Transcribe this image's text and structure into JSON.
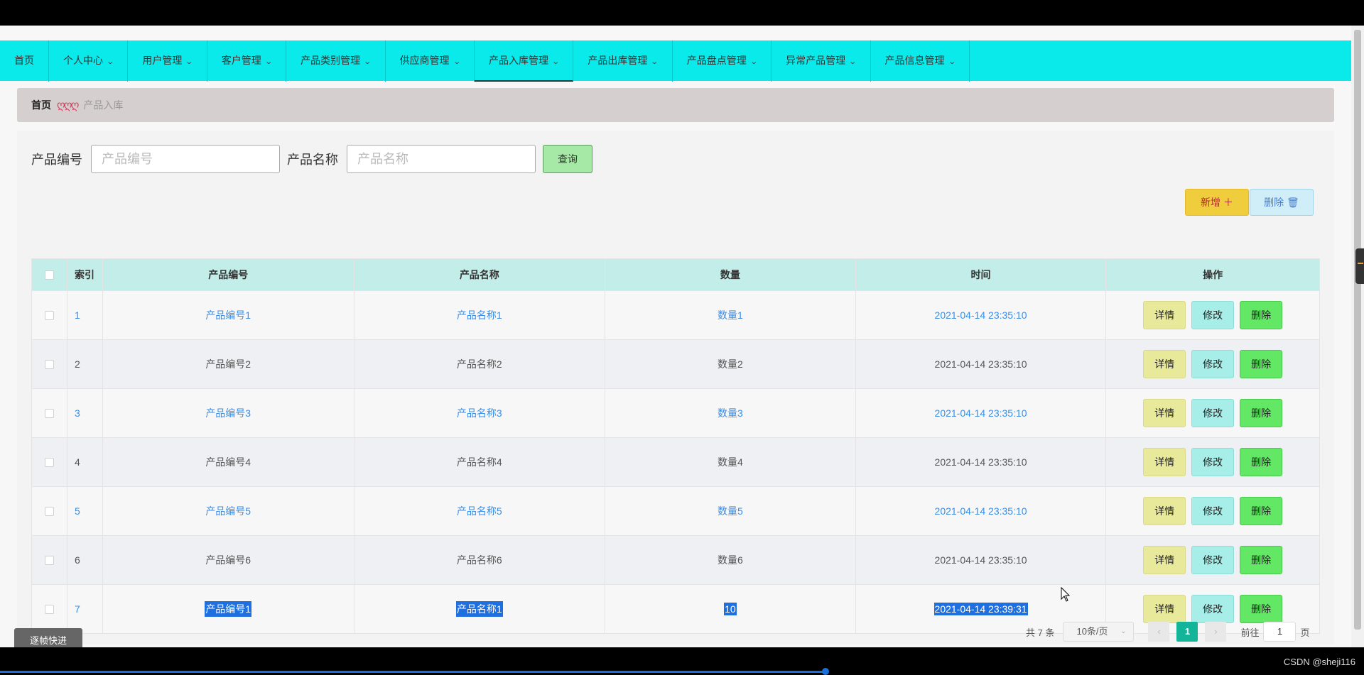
{
  "window": {
    "title_partial": ""
  },
  "nav": {
    "items": [
      {
        "label": "首页",
        "has_dropdown": false
      },
      {
        "label": "个人中心",
        "has_dropdown": true
      },
      {
        "label": "用户管理",
        "has_dropdown": true
      },
      {
        "label": "客户管理",
        "has_dropdown": true
      },
      {
        "label": "产品类别管理",
        "has_dropdown": true
      },
      {
        "label": "供应商管理",
        "has_dropdown": true
      },
      {
        "label": "产品入库管理",
        "has_dropdown": true,
        "active": true
      },
      {
        "label": "产品出库管理",
        "has_dropdown": true
      },
      {
        "label": "产品盘点管理",
        "has_dropdown": true
      },
      {
        "label": "异常产品管理",
        "has_dropdown": true
      },
      {
        "label": "产品信息管理",
        "has_dropdown": true
      }
    ],
    "chevron": "⌄"
  },
  "breadcrumb": {
    "home": "首页",
    "separator": "ღღღ",
    "current": "产品入库"
  },
  "search": {
    "code_label": "产品编号",
    "code_placeholder": "产品编号",
    "name_label": "产品名称",
    "name_placeholder": "产品名称",
    "button": "查询"
  },
  "actions": {
    "add": "新增 ＋",
    "delete": "删除 🗑"
  },
  "table": {
    "headers": {
      "index": "索引",
      "code": "产品编号",
      "name": "产品名称",
      "quantity": "数量",
      "time": "时间",
      "ops": "操作"
    },
    "op_labels": {
      "detail": "详情",
      "edit": "修改",
      "delete": "删除"
    },
    "rows": [
      {
        "index": "1",
        "code": "产品编号1",
        "name": "产品名称1",
        "quantity": "数量1",
        "time": "2021-04-14 23:35:10"
      },
      {
        "index": "2",
        "code": "产品编号2",
        "name": "产品名称2",
        "quantity": "数量2",
        "time": "2021-04-14 23:35:10"
      },
      {
        "index": "3",
        "code": "产品编号3",
        "name": "产品名称3",
        "quantity": "数量3",
        "time": "2021-04-14 23:35:10"
      },
      {
        "index": "4",
        "code": "产品编号4",
        "name": "产品名称4",
        "quantity": "数量4",
        "time": "2021-04-14 23:35:10"
      },
      {
        "index": "5",
        "code": "产品编号5",
        "name": "产品名称5",
        "quantity": "数量5",
        "time": "2021-04-14 23:35:10"
      },
      {
        "index": "6",
        "code": "产品编号6",
        "name": "产品名称6",
        "quantity": "数量6",
        "time": "2021-04-14 23:35:10"
      },
      {
        "index": "7",
        "code": "产品编号1",
        "name": "产品名称1",
        "quantity": "10",
        "time": "2021-04-14 23:39:31"
      }
    ]
  },
  "pagination": {
    "total": "共 7 条",
    "page_size": "10条/页",
    "prev": "‹",
    "current_page": "1",
    "next": "›",
    "goto_prefix": "前往",
    "goto_value": "1",
    "goto_suffix": "页"
  },
  "overlay": {
    "float_button": "逐帧快进",
    "watermark": "CSDN @sheji116"
  },
  "colors": {
    "nav_bg": "#0aeaea",
    "table_header_bg": "#c2ede8",
    "link_blue": "#3a8ee6",
    "add_button": "#f0cd3c",
    "delete_op": "#62e865",
    "page_active": "#13b49a"
  }
}
